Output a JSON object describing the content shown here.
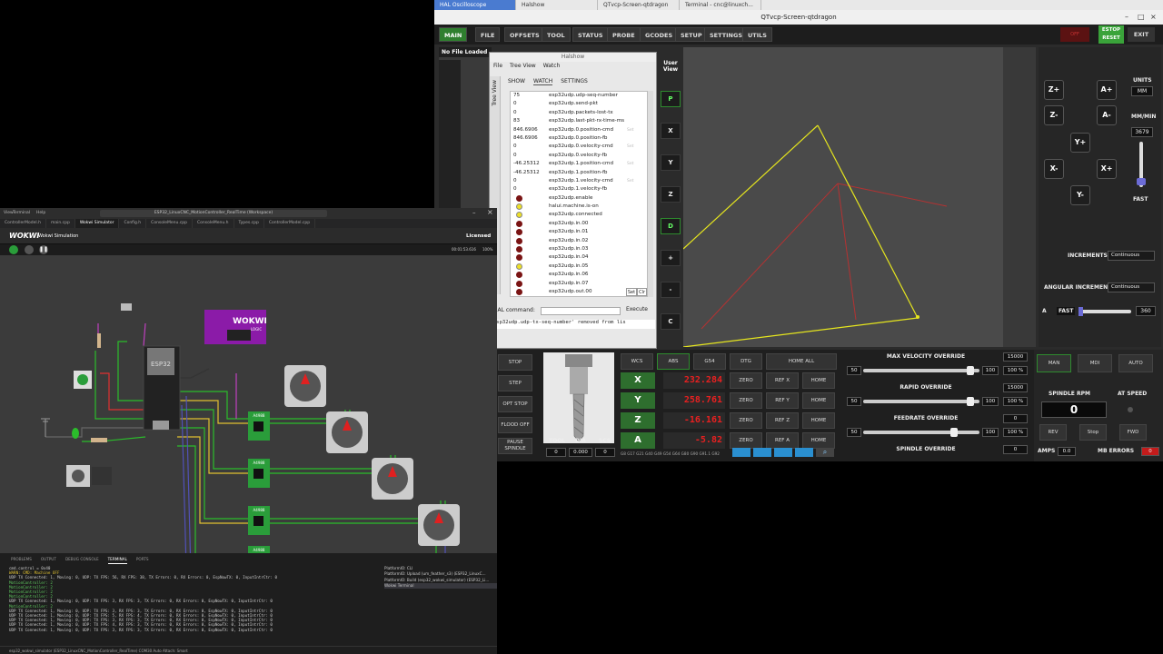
{
  "taskbar": [
    "HAL Oscilloscope",
    "Halshow",
    "QTvcp-Screen-qtdragon",
    "Terminal - cnc@linuxch..."
  ],
  "qtdragon": {
    "title": "QTvcp-Screen-qtdragon",
    "tabs": [
      "MAIN",
      "FILE",
      "OFFSETS",
      "TOOL",
      "STATUS",
      "PROBE",
      "GCODES",
      "SETUP",
      "SETTINGS",
      "UTILS"
    ],
    "off_label": "OFF",
    "estop_label": "ESTOP RESET",
    "exit_label": "EXIT",
    "file_panel_header": "No File Loaded",
    "user_view": "User View",
    "view_buttons": [
      "P",
      "X",
      "Y",
      "Z",
      "D",
      "+",
      "-",
      "C"
    ],
    "jog": {
      "units_label": "UNITS",
      "units_value": "MM",
      "rate_label": "MM/MIN",
      "rate_value": "3679",
      "fast_label": "FAST",
      "increments_label": "INCREMENTS",
      "increments_value": "Continuous",
      "angular_label": "ANGULAR INCREMENT",
      "angular_value": "Continuous",
      "a_label": "A",
      "a_fast_label": "FAST",
      "a_value": "360",
      "buttons": [
        "Z+",
        "A+",
        "Z-",
        "A-",
        "Y+",
        "X-",
        "X+",
        "Y-"
      ]
    },
    "left_buttons": [
      "STOP",
      "STEP",
      "OPT STOP",
      "FLOOD OFF",
      "PAUSE SPINDLE"
    ],
    "tool": {
      "labels": [
        "TOOL",
        "DIA",
        "SCS"
      ],
      "values": [
        "0",
        "0.000",
        "0"
      ]
    },
    "dro": {
      "header_buttons": [
        "WCS",
        "ABS",
        "G54",
        "DTG",
        "HOME ALL"
      ],
      "axes": [
        {
          "axis": "X",
          "value": "232.284",
          "b1": "ZERO",
          "b2": "REF X",
          "b3": "HOME"
        },
        {
          "axis": "Y",
          "value": "258.761",
          "b1": "ZERO",
          "b2": "REF Y",
          "b3": "HOME"
        },
        {
          "axis": "Z",
          "value": "-16.161",
          "b1": "ZERO",
          "b2": "REF Z",
          "b3": "HOME"
        },
        {
          "axis": "A",
          "value": "-5.82",
          "b1": "ZERO",
          "b2": "REF A",
          "b3": "HOME"
        }
      ],
      "gcodes_line": "G8 G17 G21 G40 G49 G54 G64 G80 G90 G91.1 G92"
    },
    "overrides": [
      {
        "title": "MAX VELOCITY OVERRIDE",
        "min": "50",
        "max": "100",
        "value": "15000",
        "percent": "100 %",
        "level": 0.95
      },
      {
        "title": "RAPID OVERRIDE",
        "min": "50",
        "max": "100",
        "value": "15000",
        "percent": "100 %",
        "level": 0.95
      },
      {
        "title": "FEEDRATE OVERRIDE",
        "min": "50",
        "max": "100",
        "value": "0",
        "percent": "100 %",
        "level": 0.8
      },
      {
        "title": "SPINDLE OVERRIDE",
        "min": "",
        "max": "",
        "value": "0",
        "percent": "",
        "level": 0
      }
    ],
    "spindle": {
      "modes": [
        "MAN",
        "MDI",
        "AUTO"
      ],
      "rpm_label": "SPINDLE RPM",
      "at_speed_label": "AT SPEED",
      "rpm_value": "0",
      "buttons": [
        "REV",
        "Stop",
        "FWD"
      ],
      "amps_label": "AMPS",
      "amps_value": "0.0",
      "mb_errors_label": "MB ERRORS",
      "mb_errors_value": "0"
    }
  },
  "halshow": {
    "title": "Halshow",
    "menu": [
      "File",
      "Tree View",
      "Watch"
    ],
    "tree_label": "Tree View",
    "tabs": [
      "SHOW",
      "WATCH",
      "SETTINGS"
    ],
    "rows": [
      {
        "value": "75",
        "name": "esp32udp.udp-seq-number",
        "set": false
      },
      {
        "value": "0",
        "name": "esp32udp.send-pkt",
        "set": false
      },
      {
        "value": "0",
        "name": "esp32udp.packets-lost-tx",
        "set": false
      },
      {
        "value": "83",
        "name": "esp32udp.last-pkt-rx-time-ms",
        "set": false
      },
      {
        "value": "846.6906",
        "name": "esp32udp.0.position-cmd",
        "set": true
      },
      {
        "value": "846.6906",
        "name": "esp32udp.0.position-fb",
        "set": false
      },
      {
        "value": "0",
        "name": "esp32udp.0.velocity-cmd",
        "set": true
      },
      {
        "value": "0",
        "name": "esp32udp.0.velocity-fb",
        "set": false
      },
      {
        "value": "-46.25312",
        "name": "esp32udp.1.position-cmd",
        "set": true
      },
      {
        "value": "-46.25312",
        "name": "esp32udp.1.position-fb",
        "set": false
      },
      {
        "value": "0",
        "name": "esp32udp.1.velocity-cmd",
        "set": true
      },
      {
        "value": "0",
        "name": "esp32udp.1.velocity-fb",
        "set": false
      }
    ],
    "bits": [
      {
        "on": false,
        "name": "esp32udp.enable"
      },
      {
        "on": true,
        "name": "halui.machine.is-on"
      },
      {
        "on": true,
        "name": "esp32udp.connected"
      },
      {
        "on": false,
        "name": "esp32udp.in.00"
      },
      {
        "on": false,
        "name": "esp32udp.in.01"
      },
      {
        "on": false,
        "name": "esp32udp.in.02"
      },
      {
        "on": false,
        "name": "esp32udp.in.03"
      },
      {
        "on": false,
        "name": "esp32udp.in.04"
      },
      {
        "on": true,
        "name": "esp32udp.in.05"
      },
      {
        "on": false,
        "name": "esp32udp.in.06"
      },
      {
        "on": false,
        "name": "esp32udp.in.07"
      },
      {
        "on": false,
        "name": "esp32udp.out.00"
      }
    ],
    "set_label": "Set",
    "clr_label": "Clr",
    "hal_command_label": "HAL command:",
    "execute_label": "Execute",
    "message": "esp32udp.udp-tx-seq-number' removed from lis"
  },
  "vscode": {
    "menu": [
      "View",
      "Terminal",
      "Help"
    ],
    "search_text": "ESP32_LinuxCNC_MotionController_RealTime (Workspace)",
    "tabs": [
      "ControllerModel.h",
      "main.cpp",
      "Wokwi Simulator",
      "Config.h",
      "ConsoleMenu.cpp",
      "ConsoleMenu.h",
      "Types.cpp",
      "ControllerModel.cpp"
    ],
    "wokwi_title": "Wokwi Simulation",
    "licensed": "Licensed",
    "sim_timer": "00:01:53.616",
    "sim_cpu": "100%",
    "logic_label": "WOKWI",
    "logic_sub": "LOGIC",
    "esp_label": "ESP32",
    "driver_label": "A4988",
    "panel_tabs": [
      "PROBLEMS",
      "OUTPUT",
      "DEBUG CONSOLE",
      "TERMINAL",
      "PORTS"
    ],
    "terminal_lines": [
      "cmd.control = 0x40",
      "WARN: CMD: Machine OFF",
      "UDP TX Connected: 1, Moving: 0, UDP: TX FPS: 56, RX FPS: 38, TX Errors: 0, RX Errors: 0, EspNowTX: 0, InputIntrCtr: 0",
      "MotionController: 2",
      "MotionController: 2",
      "MotionController: 2",
      "MotionController: 2",
      "UDP TX Connected: 1, Moving: 0, UDP: TX FPS: 3, RX FPS: 3, TX Errors: 0, RX Errors: 0, EspNowTX: 0, InputIntrCtr: 0",
      "MotionController: 2",
      "UDP TX Connected: 1, Moving: 0, UDP: TX FPS: 3, RX FPS: 3, TX Errors: 0, RX Errors: 0, EspNowTX: 0, InputIntrCtr: 0",
      "UDP TX Connected: 1, Moving: 0, UDP: TX FPS: 5, RX FPS: 4, TX Errors: 0, RX Errors: 0, EspNowTX: 0, InputIntrCtr: 0",
      "UDP TX Connected: 1, Moving: 0, UDP: TX FPS: 3, RX FPS: 3, TX Errors: 0, RX Errors: 0, EspNowTX: 0, InputIntrCtr: 0",
      "UDP TX Connected: 1, Moving: 0, UDP: TX FPS: 4, RX FPS: 3, TX Errors: 0, RX Errors: 0, EspNowTX: 0, InputIntrCtr: 0",
      "UDP TX Connected: 1, Moving: 0, UDP: TX FPS: 3, RX FPS: 3, TX Errors: 0, RX Errors: 0, EspNowTX: 0, InputIntrCtr: 0"
    ],
    "terminal_list": [
      "PlatformIO: CLI",
      "PlatformIO: Upload (um_feather_s3) (ESP32_LinuxC...",
      "PlatformIO: Build (esp32_wokwi_simulator) (ESP32_Li...",
      "Wokwi Terminal"
    ],
    "status": "esp32_wokwi_simulator (ESP32_LinuxCNC_MotionController_RealTime)   COM30   Auto Attach: Smart"
  },
  "colors": {
    "dro_value": "#e82020",
    "accent_green": "#2f7f2f",
    "preview_path": "#e6e61e",
    "preview_rapid": "#b43232"
  }
}
